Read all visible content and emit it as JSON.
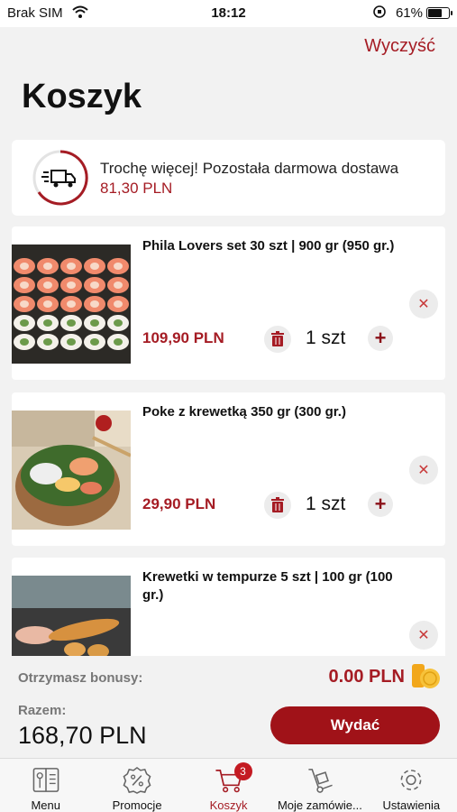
{
  "status_bar": {
    "carrier": "Brak SIM",
    "time": "18:12",
    "battery_percent": "61%",
    "battery_level": 0.61
  },
  "header": {
    "clear_label": "Wyczyść",
    "title": "Koszyk"
  },
  "delivery_banner": {
    "message": "Trochę więcej! Pozostała darmowa dostawa",
    "amount": "81,30 PLN",
    "icon": "delivery-truck-icon"
  },
  "cart_items": [
    {
      "name": "Phila Lovers set 30 szt | 900 gr (950 gr.)",
      "price": "109,90 PLN",
      "quantity": "1 szt"
    },
    {
      "name": "Poke z krewetką 350 gr (300 gr.)",
      "price": "29,90 PLN",
      "quantity": "1 szt"
    },
    {
      "name": "Krewetki w tempurze 5 szt | 100 gr (100 gr.)"
    }
  ],
  "summary": {
    "bonus_label": "Otrzymasz bonusy:",
    "bonus_value": "0.00 PLN",
    "total_label": "Razem:",
    "total_value": "168,70 PLN",
    "checkout_label": "Wydać"
  },
  "tabbar": {
    "tabs": [
      {
        "label": "Menu",
        "icon": "menu-book-icon"
      },
      {
        "label": "Promocje",
        "icon": "percent-badge-icon"
      },
      {
        "label": "Koszyk",
        "icon": "cart-icon",
        "badge": "3",
        "active": true
      },
      {
        "label": "Moje zamówie...",
        "icon": "hand-truck-icon"
      },
      {
        "label": "Ustawienia",
        "icon": "gear-icon"
      }
    ]
  },
  "colors": {
    "accent": "#a51c24",
    "button": "#a01218",
    "background": "#f2f2f2"
  }
}
